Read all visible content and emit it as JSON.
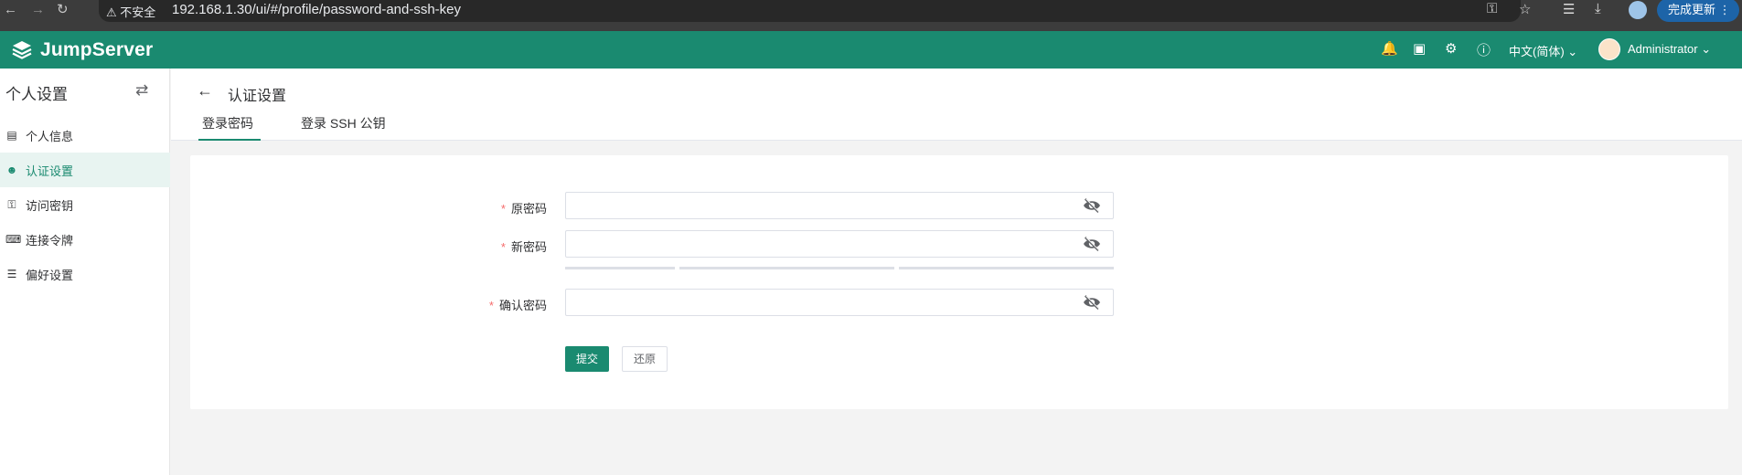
{
  "browser": {
    "back_icon": "arrow-left-icon",
    "forward_icon": "arrow-right-icon",
    "reload_icon": "reload-icon",
    "security_label": "不安全",
    "url": "192.168.1.30/ui/#/profile/password-and-ssh-key",
    "update_label": "完成更新"
  },
  "header": {
    "brand": "JumpServer",
    "language": "中文(简体)",
    "username": "Administrator",
    "accent_color": "#1a8a70"
  },
  "sidebar": {
    "title": "个人设置",
    "items": [
      {
        "label": "个人信息",
        "icon": "id-card-icon",
        "active": false
      },
      {
        "label": "认证设置",
        "icon": "user-lock-icon",
        "active": true
      },
      {
        "label": "访问密钥",
        "icon": "key-icon",
        "active": false
      },
      {
        "label": "连接令牌",
        "icon": "token-icon",
        "active": false
      },
      {
        "label": "偏好设置",
        "icon": "sliders-icon",
        "active": false
      }
    ]
  },
  "page": {
    "title": "认证设置",
    "tabs": [
      {
        "label": "登录密码",
        "active": true
      },
      {
        "label": "登录 SSH 公钥",
        "active": false
      }
    ]
  },
  "form": {
    "required_mark": "*",
    "old_password_label": "原密码",
    "new_password_label": "新密码",
    "confirm_password_label": "确认密码",
    "submit_label": "提交",
    "reset_label": "还原"
  }
}
